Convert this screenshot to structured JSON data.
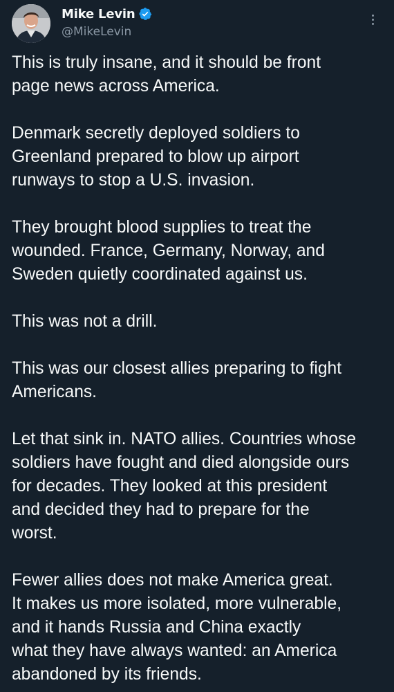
{
  "author": {
    "display_name": "Mike Levin",
    "handle": "@MikeLevin",
    "verified": true,
    "verified_color": "#1d9bf0",
    "avatar_icon": "profile-photo"
  },
  "menu": {
    "icon": "more-options-icon"
  },
  "tweet": {
    "paragraphs": [
      "This is truly insane, and it should be front\npage news across America.",
      "Denmark secretly deployed soldiers to\nGreenland prepared to blow up airport\nrunways to stop a U.S. invasion.",
      "They brought blood supplies to treat the\nwounded. France, Germany, Norway, and\nSweden quietly coordinated against us.",
      "This was not a drill.",
      "This was our closest allies preparing to fight\nAmericans.",
      "Let that sink in. NATO allies. Countries whose\nsoldiers have fought and died alongside ours\nfor decades. They looked at this president\nand decided they had to prepare for the\nworst.",
      "Fewer allies does not make America great.\nIt makes us more isolated, more vulnerable,\nand it hands Russia and China exactly\nwhat they have always wanted: an America\nabandoned by its friends."
    ]
  },
  "colors": {
    "background": "#15202b",
    "text": "#f7f9f9",
    "secondary_text": "#8b98a5"
  }
}
